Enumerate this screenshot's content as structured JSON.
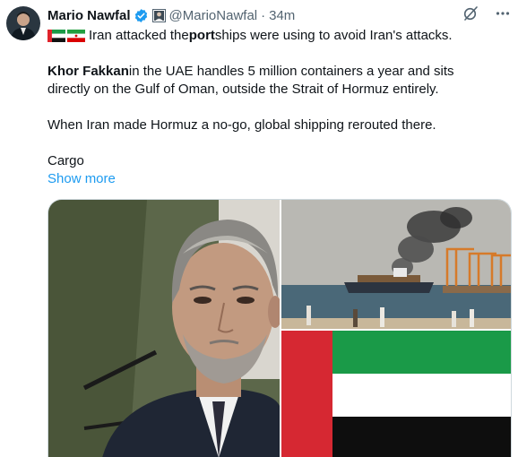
{
  "author": {
    "name": "Mario Nawfal",
    "handle": "@MarioNawfal",
    "separator": "·",
    "time": "34m"
  },
  "tweet": {
    "line1_pre": "Iran attacked the ",
    "line1_bold": "port",
    "line1_post": " ships were using to avoid Iran's attacks.",
    "para2_bold": "Khor Fakkan",
    "para2_rest_line1": " in the UAE handles 5 million containers a year and sits",
    "para2_line2": "directly on the Gulf of Oman, outside the Strait of Hormuz entirely.",
    "para3": "When Iran made Hormuz a no-go, global shipping rerouted there.",
    "para4": "Cargo",
    "show_more": "Show more"
  },
  "colors": {
    "link": "#1d9bf0",
    "secondary_text": "#536471",
    "verified": "#1d9bf0"
  },
  "icons": [
    "uae-flag-icon",
    "iran-flag-icon",
    "verified-badge-icon",
    "affiliate-badge-icon",
    "grok-icon",
    "more-icon"
  ]
}
